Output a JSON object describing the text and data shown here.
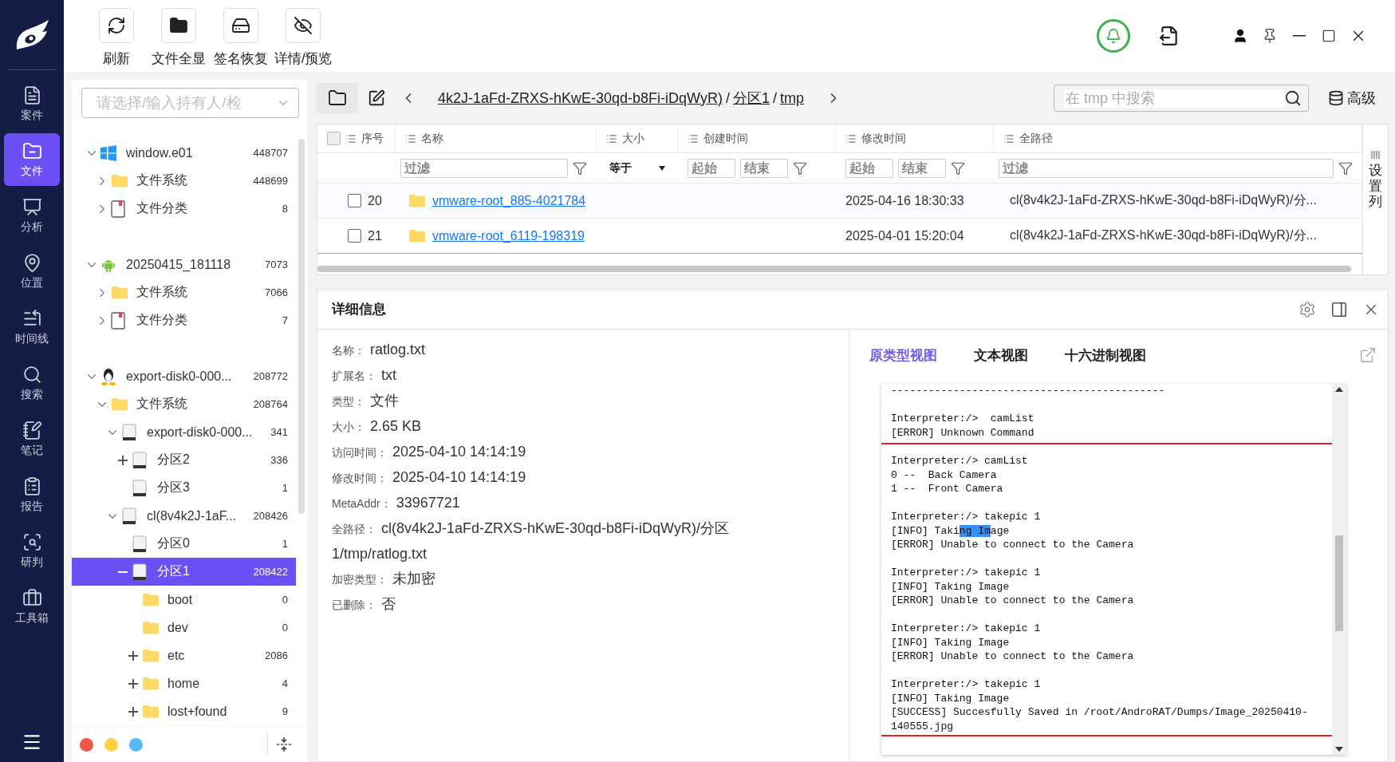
{
  "nav_items": [
    {
      "label": "案件",
      "kind": "case",
      "selected": false
    },
    {
      "label": "文件",
      "kind": "file",
      "selected": true
    },
    {
      "label": "分析",
      "kind": "analysis",
      "selected": false
    },
    {
      "label": "位置",
      "kind": "location",
      "selected": false
    },
    {
      "label": "时间线",
      "kind": "timeline",
      "selected": false
    },
    {
      "label": "搜索",
      "kind": "search",
      "selected": false
    },
    {
      "label": "笔记",
      "kind": "notes",
      "selected": false
    },
    {
      "label": "报告",
      "kind": "report",
      "selected": false
    },
    {
      "label": "研判",
      "kind": "judge",
      "selected": false
    },
    {
      "label": "工具箱",
      "kind": "toolbox",
      "selected": false
    }
  ],
  "toolbar": [
    {
      "label": "刷新",
      "kind": "refresh"
    },
    {
      "label": "文件全显",
      "kind": "folder"
    },
    {
      "label": "签名恢复",
      "kind": "restore"
    },
    {
      "label": "详情/预览",
      "kind": "preview"
    }
  ],
  "owner_select": {
    "placeholder": "请选择/输入持有人/检"
  },
  "tree": [
    {
      "label": "window.e01",
      "count": "448707",
      "kind": "windows",
      "toggle": {
        "kind": "chevron",
        "expanded": true
      },
      "selected": false,
      "children": [
        {
          "label": "文件系统",
          "count": "448699",
          "kind": "folder",
          "toggle": {
            "kind": "chevron",
            "expanded": false
          },
          "selected": false
        },
        {
          "label": "文件分类",
          "count": "8",
          "kind": "category",
          "toggle": {
            "kind": "chevron",
            "expanded": false
          },
          "selected": false
        }
      ]
    },
    {
      "label": "20250415_181118",
      "count": "7073",
      "kind": "android",
      "toggle": {
        "kind": "chevron",
        "expanded": true
      },
      "selected": false,
      "children": [
        {
          "label": "文件系统",
          "count": "7066",
          "kind": "folder",
          "toggle": {
            "kind": "chevron",
            "expanded": false
          },
          "selected": false
        },
        {
          "label": "文件分类",
          "count": "7",
          "kind": "category",
          "toggle": {
            "kind": "chevron",
            "expanded": false
          },
          "selected": false
        }
      ]
    },
    {
      "label": "export-disk0-000...",
      "count": "208772",
      "kind": "linux",
      "toggle": {
        "kind": "chevron",
        "expanded": true
      },
      "selected": false,
      "children": [
        {
          "label": "文件系统",
          "count": "208764",
          "kind": "folder",
          "toggle": {
            "kind": "chevron",
            "expanded": true
          },
          "selected": false,
          "children": [
            {
              "label": "export-disk0-000...",
              "count": "341",
              "kind": "disk",
              "toggle": {
                "kind": "chevron",
                "expanded": true
              },
              "selected": false,
              "children": [
                {
                  "label": "分区2",
                  "count": "336",
                  "kind": "disk",
                  "toggle": {
                    "kind": "plus",
                    "expanded": false
                  },
                  "selected": false
                },
                {
                  "label": "分区3",
                  "count": "1",
                  "kind": "disk",
                  "selected": false
                }
              ]
            },
            {
              "label": "cl(8v4k2J-1aF...",
              "count": "208426",
              "kind": "disk",
              "toggle": {
                "kind": "chevron",
                "expanded": true
              },
              "selected": false,
              "children": [
                {
                  "label": "分区0",
                  "count": "1",
                  "kind": "disk",
                  "selected": false
                },
                {
                  "label": "分区1",
                  "count": "208422",
                  "kind": "disk",
                  "toggle": {
                    "kind": "plus",
                    "expanded": true
                  },
                  "selected": true,
                  "children": [
                    {
                      "label": "boot",
                      "count": "0",
                      "kind": "folder",
                      "selected": false
                    },
                    {
                      "label": "dev",
                      "count": "0",
                      "kind": "folder",
                      "selected": false
                    },
                    {
                      "label": "etc",
                      "count": "2086",
                      "kind": "folder",
                      "toggle": {
                        "kind": "plus",
                        "expanded": false
                      },
                      "selected": false
                    },
                    {
                      "label": "home",
                      "count": "4",
                      "kind": "folder",
                      "toggle": {
                        "kind": "plus",
                        "expanded": false
                      },
                      "selected": false
                    },
                    {
                      "label": "lost+found",
                      "count": "9",
                      "kind": "folder",
                      "toggle": {
                        "kind": "plus",
                        "expanded": false
                      },
                      "selected": false
                    }
                  ]
                }
              ]
            }
          ]
        }
      ]
    }
  ],
  "color_dots": [
    {
      "color": "#f5564a"
    },
    {
      "color": "#fdd13f"
    },
    {
      "color": "#55b8f7"
    }
  ],
  "breadcrumb": {
    "parts": [
      {
        "kind": "link",
        "text": "4k2J-1aFd-ZRXS-hKwE-30qd-b8Fi-iDqWyR)"
      },
      {
        "kind": "separator",
        "text": "/"
      },
      {
        "kind": "link",
        "text": "分区1"
      },
      {
        "kind": "separator",
        "text": "/"
      },
      {
        "kind": "link",
        "text": "tmp"
      }
    ],
    "search": {
      "placeholder": "在 tmp 中搜索"
    },
    "advanced": "高级"
  },
  "table": {
    "select_all": {
      "checked": false
    },
    "columns": [
      {
        "label": "序号",
        "filter": {
          "kind": "none"
        }
      },
      {
        "label": "名称",
        "filter": {
          "kind": "text",
          "placeholder": "过滤"
        }
      },
      {
        "label": "大小",
        "filter": {
          "kind": "select",
          "value": "等于"
        }
      },
      {
        "label": "创建时间",
        "filter": {
          "kind": "range",
          "from_placeholder": "起始",
          "to_placeholder": "结束"
        }
      },
      {
        "label": "修改时间",
        "filter": {
          "kind": "range",
          "from_placeholder": "起始",
          "to_placeholder": "结束"
        }
      },
      {
        "label": "全路径",
        "filter": {
          "kind": "text",
          "placeholder": "过滤"
        }
      }
    ],
    "rows": [
      {
        "seq": "20",
        "checked": false,
        "name": "vmware-root_885-4021784",
        "modified": "2025-04-16 18:30:33",
        "path": "cl(8v4k2J-1aFd-ZRXS-hKwE-30qd-b8Fi-iDqWyR)/分..."
      },
      {
        "seq": "21",
        "checked": false,
        "name": "vmware-root_6119-198319",
        "modified": "2025-04-01 15:20:04",
        "path": "cl(8v4k2J-1aFd-ZRXS-hKwE-30qd-b8Fi-iDqWyR)/分..."
      }
    ],
    "column_settings": "设置列"
  },
  "details": {
    "title": "详细信息",
    "fields": [
      {
        "label": "名称：",
        "value": "ratlog.txt"
      },
      {
        "label": "扩展名：",
        "value": "txt"
      },
      {
        "label": "类型：",
        "value": "文件"
      },
      {
        "label": "大小：",
        "value": "2.65 KB"
      },
      {
        "label": "访问时间：",
        "value": "2025-04-10 14:14:19"
      },
      {
        "label": "修改时间：",
        "value": "2025-04-10 14:14:19"
      },
      {
        "label": "MetaAddr：",
        "value": "33967721"
      },
      {
        "label": "全路径：",
        "value": "cl(8v4k2J-1aFd-ZRXS-hKwE-30qd-b8Fi-iDqWyR)/分区1/tmp/ratlog.txt"
      },
      {
        "label": "加密类型：",
        "value": "未加密"
      },
      {
        "label": "已删除：",
        "value": "否"
      }
    ],
    "viewer_tabs": [
      {
        "label": "原类型视图",
        "selected": true
      },
      {
        "label": "文本视图",
        "selected": false
      },
      {
        "label": "十六进制视图",
        "selected": false
      }
    ],
    "log": [
      {
        "highlighted": false,
        "lines": [
          {
            "text": "--------------------------------------------"
          }
        ]
      },
      {
        "highlighted": false,
        "lines": [
          {
            "text": "Interpreter:/>  camList"
          },
          {
            "text": "[ERROR] Unknown Command"
          }
        ]
      },
      {
        "highlighted": true,
        "lines": [
          {
            "text": "Interpreter:/> camList"
          },
          {
            "text": "0 --  Back Camera"
          },
          {
            "text": "1 --  Front Camera"
          }
        ]
      },
      {
        "highlighted": true,
        "lines": [
          {
            "text": "Interpreter:/> takepic 1"
          },
          {
            "parts": [
              {
                "text": "[INFO] Taki",
                "selected": false
              },
              {
                "text": "ng Im",
                "selected": true
              },
              {
                "text": "age",
                "selected": false
              }
            ]
          },
          {
            "text": "[ERROR] Unable to connect to the Camera"
          }
        ]
      },
      {
        "highlighted": true,
        "lines": [
          {
            "text": "Interpreter:/> takepic 1"
          },
          {
            "text": "[INFO] Taking Image"
          },
          {
            "text": "[ERROR] Unable to connect to the Camera"
          }
        ]
      },
      {
        "highlighted": true,
        "lines": [
          {
            "text": "Interpreter:/> takepic 1"
          },
          {
            "text": "[INFO] Taking Image"
          },
          {
            "text": "[ERROR] Unable to connect to the Camera"
          }
        ]
      },
      {
        "highlighted": true,
        "lines": [
          {
            "text": "Interpreter:/> takepic 1"
          },
          {
            "text": "[INFO] Taking Image"
          },
          {
            "text": "[SUCCESS] Succesfully Saved in /root/AndroRAT/Dumps/Image_20250410-"
          },
          {
            "text": "140555.jpg"
          }
        ]
      }
    ]
  }
}
